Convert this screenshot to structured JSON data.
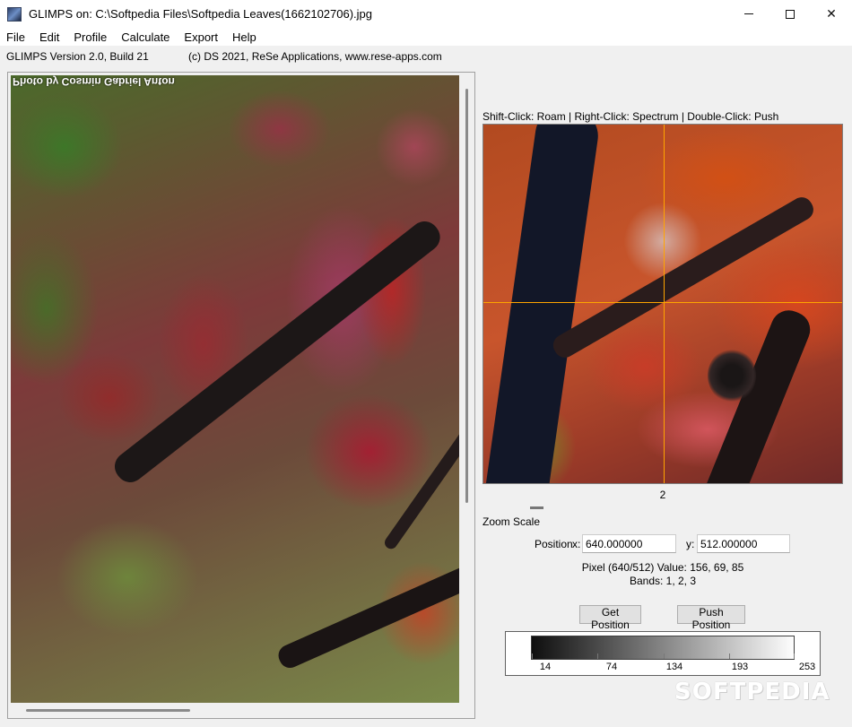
{
  "window": {
    "title": "GLIMPS on: C:\\Softpedia Files\\Softpedia Leaves(1662102706).jpg",
    "minimize_symbol": "",
    "maximize_symbol": "",
    "close_symbol": "✕"
  },
  "menu": {
    "items": [
      {
        "label": "File"
      },
      {
        "label": "Edit"
      },
      {
        "label": "Profile"
      },
      {
        "label": "Calculate"
      },
      {
        "label": "Export"
      },
      {
        "label": "Help"
      }
    ]
  },
  "info": {
    "version": "GLIMPS Version 2.0, Build   21",
    "copyright": "(c) DS 2021, ReSe Applications, www.rese-apps.com"
  },
  "image_panel": {
    "photo_credit": "Photo by Cosmin Gabriel Anton"
  },
  "zoom_panel": {
    "hint": "Shift-Click: Roam | Right-Click: Spectrum | Double-Click: Push",
    "zoom_value": "2",
    "zoom_label": "Zoom Scale",
    "crosshair_color": "#ffa500"
  },
  "position": {
    "label": "Position",
    "x_label": "x:",
    "x_value": "640.000000",
    "y_label": "y:",
    "y_value": "512.000000"
  },
  "pixel": {
    "value_text": "Pixel (640/512) Value: 156, 69, 85",
    "bands_text": "Bands:  1,  2,  3"
  },
  "buttons": {
    "get_position": "Get Position",
    "push_position": "Push Position"
  },
  "scale": {
    "ticks": [
      "14",
      "74",
      "134",
      "193",
      "253"
    ]
  },
  "watermark": "SOFTPEDIA"
}
